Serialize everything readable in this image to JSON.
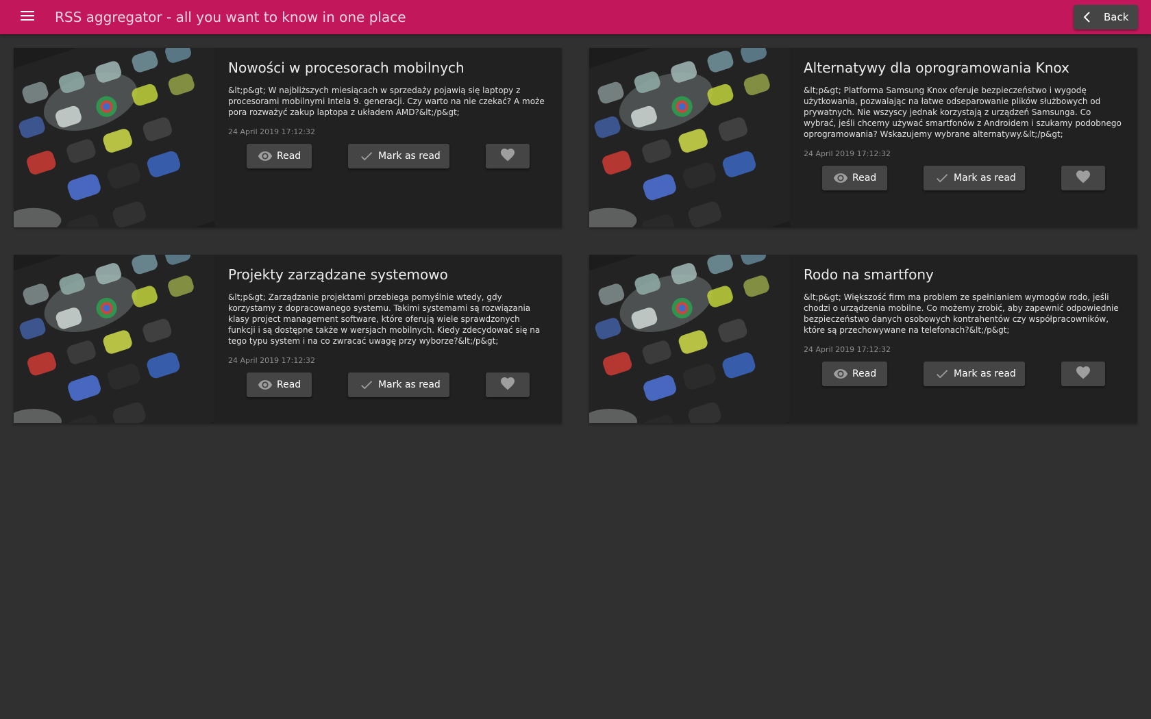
{
  "header": {
    "title": "RSS aggregator - all you want to know in one place",
    "back_label": "Back",
    "color": "#c2185b"
  },
  "icons": {
    "menu": "hamburger-menu-icon",
    "back": "chevron-left-icon",
    "read": "eye-icon",
    "mark": "check-icon",
    "favorite": "heart-icon"
  },
  "articles": [
    {
      "title": "Nowości w procesorach mobilnych",
      "description": "&lt;p&gt; W najbliższych miesiącach w sprzedaży pojawią się laptopy z procesorami mobilnymi Intela 9. generacji. Czy warto na nie czekać? A może pora rozważyć zakup laptopa z układem AMD?&lt;/p&gt;",
      "date": "24 April 2019 17:12:32",
      "read_label": "Read",
      "mark_label": "Mark as read"
    },
    {
      "title": "Alternatywy dla oprogramowania Knox",
      "description": "&lt;p&gt; Platforma Samsung Knox oferuje bezpieczeństwo i wygodę użytkowania, pozwalając na łatwe odseparowanie plików służbowych od prywatnych. Nie wszyscy jednak korzystają z urządzeń Samsunga. Co wybrać, jeśli chcemy używać smartfonów z Androidem i szukamy podobnego oprogramowania? Wskazujemy wybrane alternatywy.&lt;/p&gt;",
      "date": "24 April 2019 17:12:32",
      "read_label": "Read",
      "mark_label": "Mark as read"
    },
    {
      "title": "Projekty zarządzane systemowo",
      "description": "&lt;p&gt; Zarządzanie projektami przebiega pomyślnie wtedy, gdy korzystamy z dopracowanego systemu. Takimi systemami są rozwiązania klasy project management software, które oferują wiele sprawdzonych funkcji i są dostępne także w wersjach mobilnych. Kiedy zdecydować się na tego typu system i na co zwracać uwagę przy wyborze?&lt;/p&gt;",
      "date": "24 April 2019 17:12:32",
      "read_label": "Read",
      "mark_label": "Mark as read"
    },
    {
      "title": "Rodo na smartfony",
      "description": "&lt;p&gt; Większość firm ma problem ze spełnianiem wymogów rodo, jeśli chodzi o urządzenia mobilne. Co możemy zrobić, aby zapewnić odpowiednie bezpieczeństwo danych osobowych kontrahentów czy współpracowników, które są przechowywane na telefonach?&lt;/p&gt;",
      "date": "24 April 2019 17:12:32",
      "read_label": "Read",
      "mark_label": "Mark as read"
    }
  ]
}
